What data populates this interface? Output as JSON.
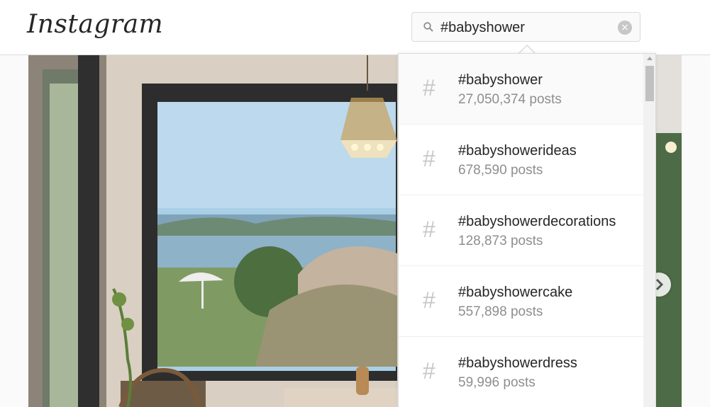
{
  "header": {
    "logo_text": "Instagram"
  },
  "search": {
    "value": "#babyshower",
    "icon": "search-icon",
    "clear_icon": "clear-icon"
  },
  "results": [
    {
      "tag": "#babyshower",
      "posts": "27,050,374 posts"
    },
    {
      "tag": "#babyshowerideas",
      "posts": "678,590 posts"
    },
    {
      "tag": "#babyshowerdecorations",
      "posts": "128,873 posts"
    },
    {
      "tag": "#babyshowercake",
      "posts": "557,898 posts"
    },
    {
      "tag": "#babyshowerdress",
      "posts": "59,996 posts"
    }
  ],
  "result_icon": "#",
  "colors": {
    "text": "#262626",
    "muted": "#8e8e8e",
    "border": "#dbdbdb",
    "hash": "#c7c7c7"
  }
}
